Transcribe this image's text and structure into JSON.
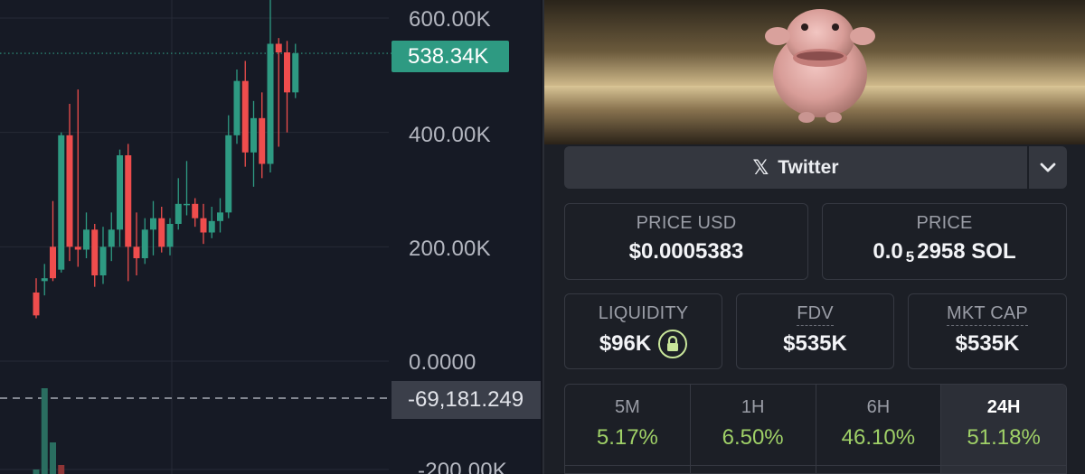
{
  "chart": {
    "y_axis_labels": [
      "600.00K",
      "400.00K",
      "200.00K",
      "0.0000",
      "-200.00K"
    ],
    "current_price_label": "538.34K",
    "crosshair_label": "-69,181.249",
    "colors": {
      "up": "#2e9a82",
      "down": "#ef4d4d",
      "background": "#161a25",
      "grid": "#262a36"
    },
    "ylim": [
      -210000,
      680000
    ],
    "candles": [
      {
        "o": 120000,
        "h": 145000,
        "l": 75000,
        "c": 80000
      },
      {
        "o": 140000,
        "h": 170000,
        "l": 115000,
        "c": 145000
      },
      {
        "o": 200000,
        "h": 280000,
        "l": 140000,
        "c": 145000
      },
      {
        "o": 160000,
        "h": 400000,
        "l": 155000,
        "c": 395000
      },
      {
        "o": 395000,
        "h": 450000,
        "l": 175000,
        "c": 200000
      },
      {
        "o": 200000,
        "h": 475000,
        "l": 165000,
        "c": 195000
      },
      {
        "o": 195000,
        "h": 260000,
        "l": 180000,
        "c": 230000
      },
      {
        "o": 230000,
        "h": 240000,
        "l": 130000,
        "c": 150000
      },
      {
        "o": 150000,
        "h": 235000,
        "l": 135000,
        "c": 200000
      },
      {
        "o": 200000,
        "h": 260000,
        "l": 175000,
        "c": 230000
      },
      {
        "o": 230000,
        "h": 370000,
        "l": 200000,
        "c": 360000
      },
      {
        "o": 360000,
        "h": 380000,
        "l": 140000,
        "c": 200000
      },
      {
        "o": 200000,
        "h": 260000,
        "l": 150000,
        "c": 180000
      },
      {
        "o": 180000,
        "h": 250000,
        "l": 170000,
        "c": 230000
      },
      {
        "o": 230000,
        "h": 280000,
        "l": 185000,
        "c": 250000
      },
      {
        "o": 250000,
        "h": 270000,
        "l": 190000,
        "c": 200000
      },
      {
        "o": 200000,
        "h": 250000,
        "l": 185000,
        "c": 240000
      },
      {
        "o": 240000,
        "h": 320000,
        "l": 230000,
        "c": 275000
      },
      {
        "o": 275000,
        "h": 350000,
        "l": 255000,
        "c": 275000
      },
      {
        "o": 275000,
        "h": 285000,
        "l": 235000,
        "c": 250000
      },
      {
        "o": 250000,
        "h": 275000,
        "l": 205000,
        "c": 225000
      },
      {
        "o": 225000,
        "h": 270000,
        "l": 215000,
        "c": 245000
      },
      {
        "o": 245000,
        "h": 285000,
        "l": 225000,
        "c": 260000
      },
      {
        "o": 260000,
        "h": 430000,
        "l": 250000,
        "c": 395000
      },
      {
        "o": 395000,
        "h": 510000,
        "l": 380000,
        "c": 490000
      },
      {
        "o": 490000,
        "h": 525000,
        "l": 340000,
        "c": 365000
      },
      {
        "o": 365000,
        "h": 455000,
        "l": 305000,
        "c": 425000
      },
      {
        "o": 425000,
        "h": 470000,
        "l": 320000,
        "c": 345000
      },
      {
        "o": 345000,
        "h": 680000,
        "l": 330000,
        "c": 555000
      },
      {
        "o": 555000,
        "h": 565000,
        "l": 375000,
        "c": 540000
      },
      {
        "o": 540000,
        "h": 560000,
        "l": 400000,
        "c": 470000
      },
      {
        "o": 470000,
        "h": 555000,
        "l": 460000,
        "c": 538340
      }
    ],
    "volume_bars": [
      {
        "index": 1,
        "value": 0.95,
        "dir": "up"
      },
      {
        "index": 2,
        "value": 0.35,
        "dir": "up"
      },
      {
        "index": 3,
        "value": 0.1,
        "dir": "down"
      },
      {
        "index": 0,
        "value": 0.05,
        "dir": "up"
      }
    ]
  },
  "token_panel": {
    "banner_image": "blobfish-meme",
    "twitter_icon": "x-logo-icon",
    "twitter_label": "Twitter",
    "price_usd": {
      "label": "PRICE USD",
      "value": "$0.0005383"
    },
    "price_native": {
      "label": "PRICE",
      "prefix": "0.0",
      "subscript": "5",
      "suffix": "2958 SOL"
    },
    "liquidity": {
      "label": "LIQUIDITY",
      "value": "$96K",
      "icon": "lock-icon"
    },
    "fdv": {
      "label": "FDV",
      "value": "$535K"
    },
    "mkt_cap": {
      "label": "MKT CAP",
      "value": "$535K"
    },
    "timeframes": [
      {
        "label": "5M",
        "value": "5.17%",
        "active": false
      },
      {
        "label": "1H",
        "value": "6.50%",
        "active": false
      },
      {
        "label": "6H",
        "value": "46.10%",
        "active": false
      },
      {
        "label": "24H",
        "value": "51.18%",
        "active": true
      }
    ]
  }
}
